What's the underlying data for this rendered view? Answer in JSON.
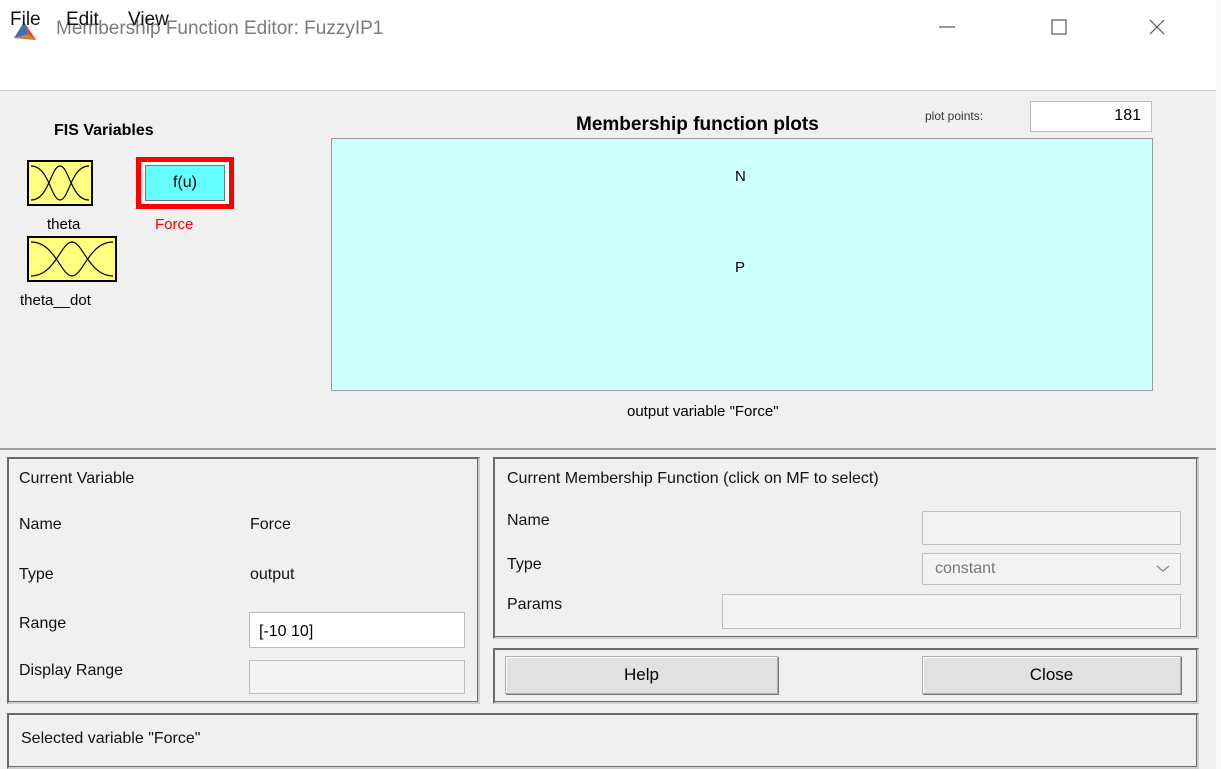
{
  "window": {
    "title": "Membership Function Editor: FuzzyIP1",
    "app_icon": "matlab-icon"
  },
  "menu": {
    "items": [
      "File",
      "Edit",
      "View"
    ]
  },
  "fis_variables": {
    "title": "FIS Variables",
    "inputs": [
      {
        "label": "theta",
        "icon": "membership-curves-icon",
        "color": "#ffff80"
      },
      {
        "label": "theta__dot",
        "icon": "membership-curves-icon",
        "color": "#ffff80"
      }
    ],
    "output": {
      "label": "Force",
      "icon_text": "f(u)",
      "color": "#66ffff",
      "selected_color": "#ff0000"
    }
  },
  "plot": {
    "title": "Membership function plots",
    "points_label": "plot points:",
    "points_value": "181",
    "mf_labels": [
      "N",
      "P"
    ],
    "caption": "output variable \"Force\"",
    "background": "#ccffff"
  },
  "current_variable": {
    "title": "Current Variable",
    "name_label": "Name",
    "name_value": "Force",
    "type_label": "Type",
    "type_value": "output",
    "range_label": "Range",
    "range_value": "[-10 10]",
    "display_range_label": "Display Range",
    "display_range_value": ""
  },
  "current_mf": {
    "title": "Current Membership Function (click on MF to select)",
    "name_label": "Name",
    "name_value": "",
    "type_label": "Type",
    "type_value": "constant",
    "params_label": "Params",
    "params_value": ""
  },
  "buttons": {
    "help": "Help",
    "close": "Close"
  },
  "status": {
    "text": "Selected variable \"Force\""
  }
}
